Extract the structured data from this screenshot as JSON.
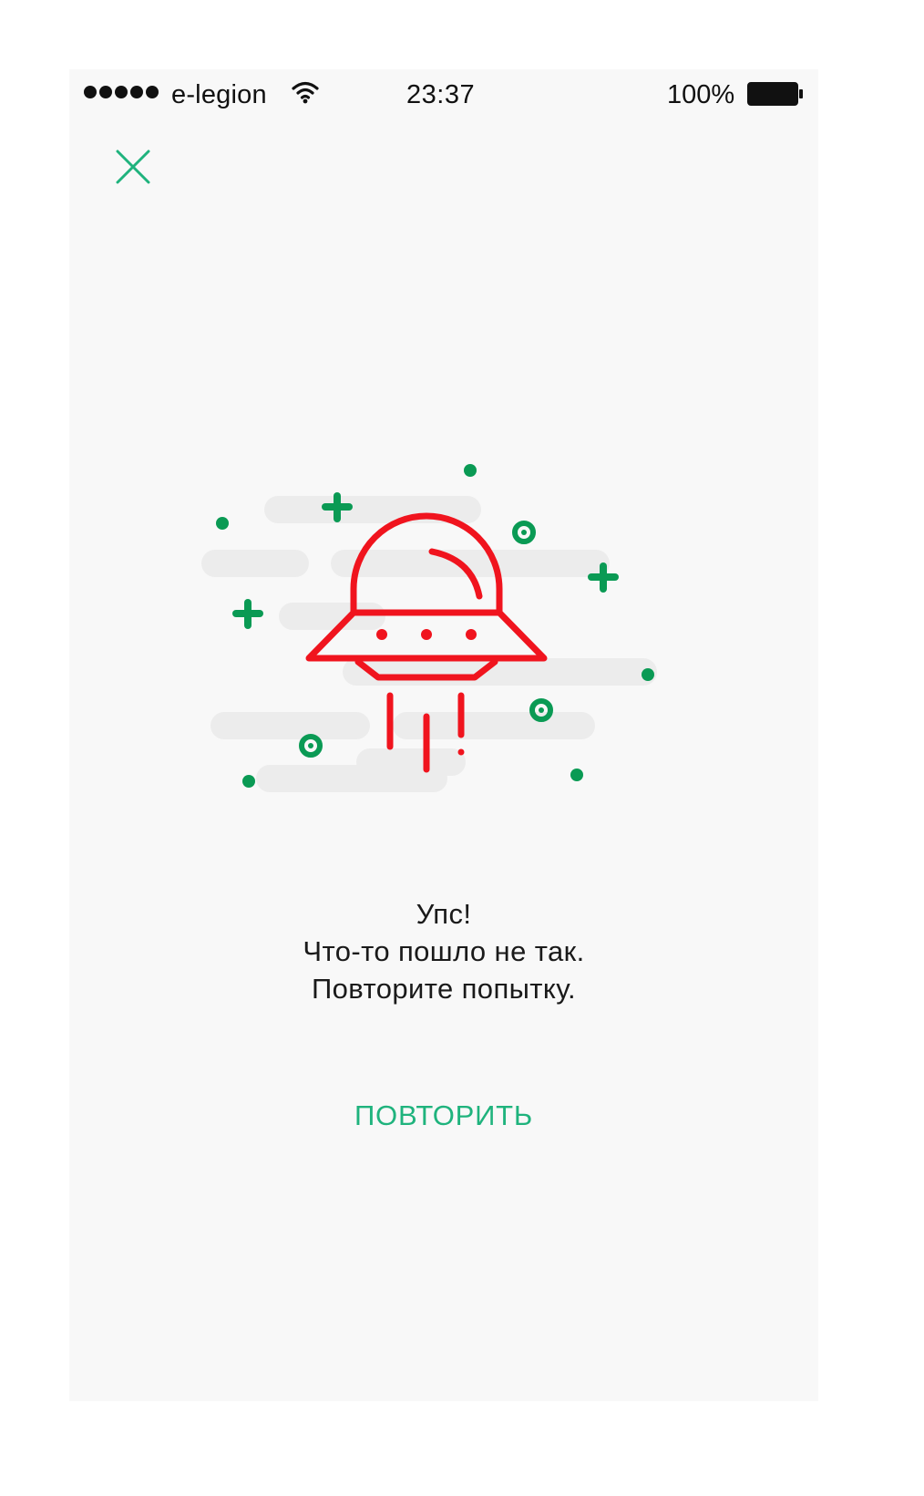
{
  "status_bar": {
    "carrier": "e-legion",
    "time": "23:37",
    "battery_percent": "100%",
    "signal_icon": "signal-dots-icon",
    "wifi_icon": "wifi-icon",
    "battery_icon": "battery-icon"
  },
  "header": {
    "close_icon": "close-icon"
  },
  "illustration": {
    "icon": "ufo-icon"
  },
  "error": {
    "line1": "Упс!",
    "line2": "Что-то пошло не так.",
    "line3": "Повторите попытку."
  },
  "actions": {
    "retry_label": "ПОВТОРИТЬ"
  },
  "colors": {
    "accent_green": "#1fb37d",
    "decor_green": "#0a9a54",
    "ufo_red": "#f0141e",
    "background": "#f8f8f8"
  }
}
